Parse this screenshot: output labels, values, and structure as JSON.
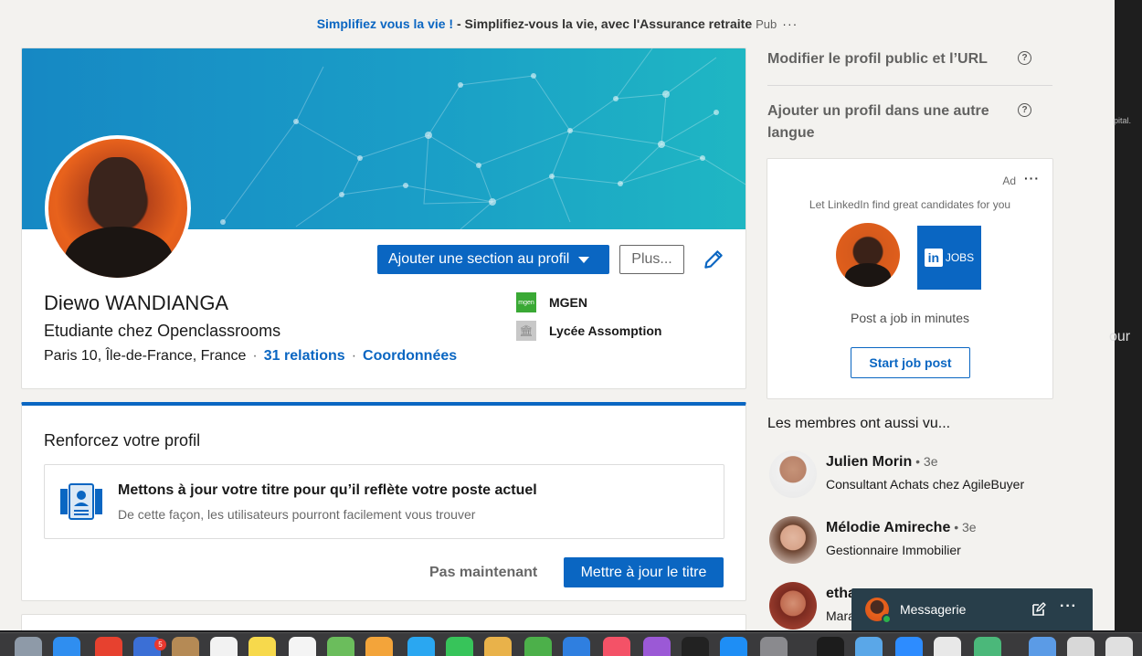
{
  "top_ad": {
    "link": "Simplifiez vous la vie !",
    "separator": " - ",
    "text": "Simplifiez-vous la vie, avec l'Assurance retraite",
    "pub": "Pub",
    "more": "···"
  },
  "profile": {
    "add_section_button": "Ajouter une section au profil",
    "more_button": "Plus...",
    "name": "Diewo WANDIANGA",
    "headline": "Etudiante chez Openclassrooms",
    "location": "Paris 10, Île-de-France, France",
    "separator": "·",
    "connections": "31 relations",
    "contact_info": "Coordonnées",
    "orgs": [
      {
        "name": "MGEN",
        "logo_text": "mgen"
      },
      {
        "name": "Lycée Assomption",
        "logo_text": "🏛"
      }
    ]
  },
  "strength": {
    "title": "Renforcez votre profil",
    "suggestion_title": "Mettons à jour votre titre pour qu’il reflète votre poste actuel",
    "suggestion_sub": "De cette façon, les utilisateurs pourront facilement vous trouver",
    "later_button": "Pas maintenant",
    "update_button": "Mettre à jour le titre"
  },
  "rail": {
    "public_profile_link": "Modifier le profil public et l’URL",
    "other_language_link": "Ajouter un profil dans une autre langue",
    "help": "?"
  },
  "ad": {
    "label": "Ad",
    "more": "···",
    "tagline": "Let LinkedIn find great candidates for you",
    "jobs_in": "in",
    "jobs_text": "JOBS",
    "cta_text": "Post a job in minutes",
    "cta_button": "Start job post"
  },
  "also_viewed": {
    "title": "Les membres ont aussi vu...",
    "members": [
      {
        "name": "Julien Morin",
        "degree": " • 3e",
        "title": "Consultant Achats chez AgileBuyer"
      },
      {
        "name": "Mélodie Amireche",
        "degree": " • 3e",
        "title": "Gestionnaire Immobilier"
      },
      {
        "name": "etha",
        "degree": "",
        "title": "Mara"
      }
    ]
  },
  "messaging": {
    "label": "Messagerie",
    "more": "···"
  },
  "background_fragments": {
    "frag1": "pital.",
    "frag2": "our"
  },
  "dock": {
    "badge": "5"
  },
  "colors": {
    "brand": "#0a66c2",
    "messaging_bar": "#283e4a",
    "online": "#2bb24c"
  }
}
